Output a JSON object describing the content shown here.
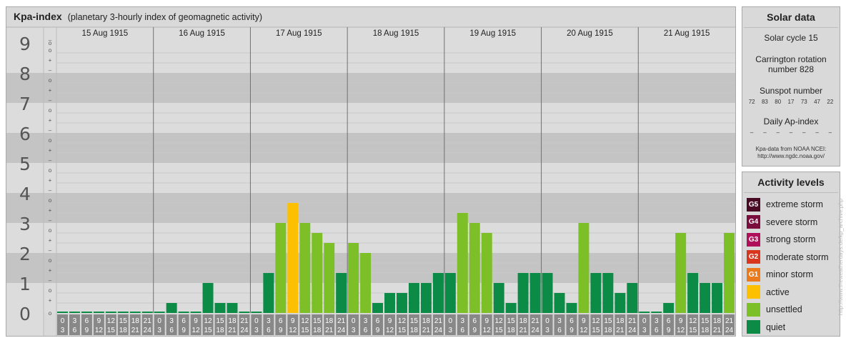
{
  "title": "Kpa-index",
  "subtitle": "(planetary 3-hourly index of geomagnetic activity)",
  "chart_data": {
    "type": "bar",
    "title": "Kpa-index",
    "subtitle": "(planetary 3-hourly index of geomagnetic activity)",
    "ylim": [
      0,
      9
    ],
    "y_ticks": [
      "0",
      "1",
      "2",
      "3",
      "4",
      "5",
      "6",
      "7",
      "8",
      "9"
    ],
    "y_minor_ticks": [
      "+",
      "o",
      "–"
    ],
    "days": [
      "15 Aug 1915",
      "16 Aug 1915",
      "17 Aug 1915",
      "18 Aug 1915",
      "19 Aug 1915",
      "20 Aug 1915",
      "21 Aug 1915"
    ],
    "interval_start_labels": [
      "0",
      "3",
      "6",
      "9",
      "12",
      "15",
      "18",
      "21"
    ],
    "interval_end_labels": [
      "3",
      "6",
      "9",
      "12",
      "15",
      "18",
      "21",
      "24"
    ],
    "values": [
      [
        0,
        0,
        0,
        0,
        0,
        0,
        0,
        0
      ],
      [
        0,
        0.333,
        0,
        0,
        1,
        0.333,
        0.333,
        0
      ],
      [
        0,
        1.333,
        3,
        3.667,
        3,
        2.667,
        2.333,
        1.333
      ],
      [
        2.333,
        2,
        0.333,
        0.667,
        0.667,
        1,
        1,
        1.333
      ],
      [
        1.333,
        3.333,
        3,
        2.667,
        1,
        0.333,
        1.333,
        1.333
      ],
      [
        1.333,
        0.667,
        0.333,
        3,
        1.333,
        1.333,
        0.667,
        1
      ],
      [
        0,
        0,
        0.333,
        2.667,
        1.333,
        1,
        1,
        2.667
      ]
    ],
    "activity": [
      [
        "quiet",
        "quiet",
        "quiet",
        "quiet",
        "quiet",
        "quiet",
        "quiet",
        "quiet"
      ],
      [
        "quiet",
        "quiet",
        "quiet",
        "quiet",
        "quiet",
        "quiet",
        "quiet",
        "quiet"
      ],
      [
        "quiet",
        "quiet",
        "unsettled",
        "active",
        "unsettled",
        "unsettled",
        "unsettled",
        "quiet"
      ],
      [
        "unsettled",
        "unsettled",
        "quiet",
        "quiet",
        "quiet",
        "quiet",
        "quiet",
        "quiet"
      ],
      [
        "quiet",
        "unsettled",
        "unsettled",
        "unsettled",
        "quiet",
        "quiet",
        "quiet",
        "quiet"
      ],
      [
        "quiet",
        "quiet",
        "quiet",
        "unsettled",
        "quiet",
        "quiet",
        "quiet",
        "quiet"
      ],
      [
        "quiet",
        "quiet",
        "quiet",
        "unsettled",
        "quiet",
        "quiet",
        "quiet",
        "unsettled"
      ]
    ],
    "colors": {
      "quiet": "#0b8b45",
      "unsettled": "#7dbf26",
      "active": "#fcc000",
      "band_dark": "#c4c4c4",
      "band_light": "#dcdcdc",
      "axis_bg": "#888888",
      "day_line": "#707070"
    }
  },
  "solar": {
    "heading": "Solar data",
    "cycle": "Solar cycle 15",
    "carrington_1": "Carrington rotation",
    "carrington_2": "number 828",
    "sunspot_label": "Sunspot number",
    "sunspots": [
      "72",
      "83",
      "80",
      "17",
      "73",
      "47",
      "22"
    ],
    "ap_label": "Daily Ap-index",
    "ap_values": [
      "–",
      "–",
      "–",
      "–",
      "–",
      "–",
      "–"
    ],
    "credit_1": "Kpa-data from NOAA NCEI:",
    "credit_2": "http://www.ngdc.noaa.gov/"
  },
  "levels": {
    "heading": "Activity levels",
    "items": [
      {
        "code": "G5",
        "label": "extreme storm",
        "color": "#4a0a24"
      },
      {
        "code": "G4",
        "label": "severe storm",
        "color": "#7a0e3c"
      },
      {
        "code": "G3",
        "label": "strong storm",
        "color": "#b0105a"
      },
      {
        "code": "G2",
        "label": "moderate storm",
        "color": "#d9361e"
      },
      {
        "code": "G1",
        "label": "minor storm",
        "color": "#ea7a1b"
      },
      {
        "code": "",
        "label": "active",
        "color": "#fcc000"
      },
      {
        "code": "",
        "label": "unsettled",
        "color": "#7dbf26"
      },
      {
        "code": "",
        "label": "quiet",
        "color": "#0b8b45"
      }
    ]
  },
  "watermark": "http://www.theweatherdays.de/kp_archive.php"
}
